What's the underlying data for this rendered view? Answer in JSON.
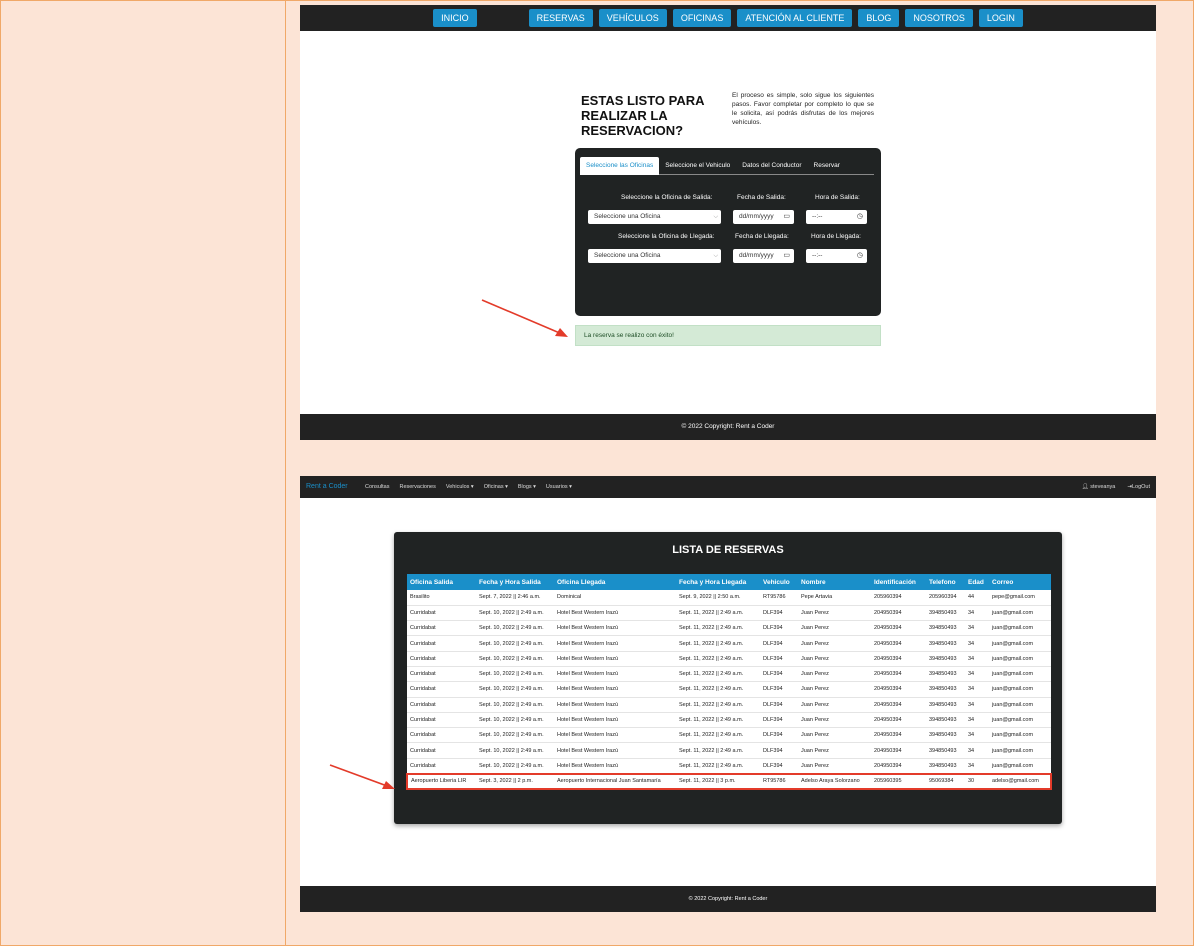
{
  "shot1": {
    "nav": [
      "INICIO",
      "RESERVAS",
      "VEHÍCULOS",
      "OFICINAS",
      "ATENCIÓN AL CLIENTE",
      "BLOG",
      "NOSOTROS",
      "LOGIN"
    ],
    "hero_title": "ESTAS LISTO PARA REALIZAR LA RESERVACION?",
    "hero_text": "El proceso es simple, solo sigue los siguientes pasos. Favor completar por completo lo que se le solicita, así podrás disfrutas de los mejores vehículos.",
    "tabs": [
      "Seleccione las Oficinas",
      "Seleccione el Vehiculo",
      "Datos del Conductor",
      "Reservar"
    ],
    "label_salida_oficina": "Seleccione la Oficina de Salida:",
    "label_fecha_salida": "Fecha de Salida:",
    "label_hora_salida": "Hora de Salida:",
    "label_llegada_oficina": "Seleccione la Oficina de Llegada:",
    "label_fecha_llegada": "Fecha de Llegada:",
    "label_hora_llegada": "Hora de Llegada:",
    "select_placeholder": "Seleccione una Oficina",
    "date_placeholder": "dd/mm/yyyy",
    "time_placeholder": "--:--",
    "success_message": "La reserva se realizo con éxito!",
    "footer": "© 2022 Copyright: Rent a Coder"
  },
  "shot2": {
    "brand": "Rent a Coder",
    "menu": [
      "Consultas",
      "Reservaciones",
      "Vehiculos ▾",
      "Oficinas ▾",
      "Blogs ▾",
      "Usuarios ▾"
    ],
    "user": "steveanya",
    "logout": "LogOut",
    "title": "LISTA DE RESERVAS",
    "columns": [
      "Oficina Salida",
      "Fecha y Hora Salida",
      "Oficina Llegada",
      "Fecha y Hora Llegada",
      "Vehiculo",
      "Nombre",
      "Identificación",
      "Telefono",
      "Edad",
      "Correo"
    ],
    "rows": [
      [
        "Brasilito",
        "Sept. 7, 2022 || 2:46 a.m.",
        "Dominical",
        "Sept. 9, 2022 || 2:50 a.m.",
        "RT95786",
        "Pepe Artavia",
        "205960394",
        "205960394",
        "44",
        "pepe@gmail.com"
      ],
      [
        "Curridabat",
        "Sept. 10, 2022 || 2:49 a.m.",
        "Hotel Best Western Irazú",
        "Sept. 11, 2022 || 2:49 a.m.",
        "DLF394",
        "Juan Perez",
        "204950394",
        "394850493",
        "34",
        "juan@gmail.com"
      ],
      [
        "Curridabat",
        "Sept. 10, 2022 || 2:49 a.m.",
        "Hotel Best Western Irazú",
        "Sept. 11, 2022 || 2:49 a.m.",
        "DLF394",
        "Juan Perez",
        "204950394",
        "394850493",
        "34",
        "juan@gmail.com"
      ],
      [
        "Curridabat",
        "Sept. 10, 2022 || 2:49 a.m.",
        "Hotel Best Western Irazú",
        "Sept. 11, 2022 || 2:49 a.m.",
        "DLF394",
        "Juan Perez",
        "204950394",
        "394850493",
        "34",
        "juan@gmail.com"
      ],
      [
        "Curridabat",
        "Sept. 10, 2022 || 2:49 a.m.",
        "Hotel Best Western Irazú",
        "Sept. 11, 2022 || 2:49 a.m.",
        "DLF394",
        "Juan Perez",
        "204950394",
        "394850493",
        "34",
        "juan@gmail.com"
      ],
      [
        "Curridabat",
        "Sept. 10, 2022 || 2:49 a.m.",
        "Hotel Best Western Irazú",
        "Sept. 11, 2022 || 2:49 a.m.",
        "DLF394",
        "Juan Perez",
        "204950394",
        "394850493",
        "34",
        "juan@gmail.com"
      ],
      [
        "Curridabat",
        "Sept. 10, 2022 || 2:49 a.m.",
        "Hotel Best Western Irazú",
        "Sept. 11, 2022 || 2:49 a.m.",
        "DLF394",
        "Juan Perez",
        "204950394",
        "394850493",
        "34",
        "juan@gmail.com"
      ],
      [
        "Curridabat",
        "Sept. 10, 2022 || 2:49 a.m.",
        "Hotel Best Western Irazú",
        "Sept. 11, 2022 || 2:49 a.m.",
        "DLF394",
        "Juan Perez",
        "204950394",
        "394850493",
        "34",
        "juan@gmail.com"
      ],
      [
        "Curridabat",
        "Sept. 10, 2022 || 2:49 a.m.",
        "Hotel Best Western Irazú",
        "Sept. 11, 2022 || 2:49 a.m.",
        "DLF394",
        "Juan Perez",
        "204950394",
        "394850493",
        "34",
        "juan@gmail.com"
      ],
      [
        "Curridabat",
        "Sept. 10, 2022 || 2:49 a.m.",
        "Hotel Best Western Irazú",
        "Sept. 11, 2022 || 2:49 a.m.",
        "DLF394",
        "Juan Perez",
        "204950394",
        "394850493",
        "34",
        "juan@gmail.com"
      ],
      [
        "Curridabat",
        "Sept. 10, 2022 || 2:49 a.m.",
        "Hotel Best Western Irazú",
        "Sept. 11, 2022 || 2:49 a.m.",
        "DLF394",
        "Juan Perez",
        "204950394",
        "394850493",
        "34",
        "juan@gmail.com"
      ],
      [
        "Curridabat",
        "Sept. 10, 2022 || 2:49 a.m.",
        "Hotel Best Western Irazú",
        "Sept. 11, 2022 || 2:49 a.m.",
        "DLF394",
        "Juan Perez",
        "204950394",
        "394850493",
        "34",
        "juan@gmail.com"
      ],
      [
        "Aeropuerto Liberia LIR",
        "Sept. 3, 2022 || 2 p.m.",
        "Aeropuerto Internacional Juan Santamaría",
        "Sept. 11, 2022 || 3 p.m.",
        "RT95786",
        "Adelso Araya Solorzano",
        "205960395",
        "95069384",
        "30",
        "adelso@gmail.com"
      ]
    ],
    "highlighted_row": 12,
    "footer": "© 2022 Copyright: Rent a Coder"
  },
  "colors": {
    "accent": "#1a8fc9",
    "annotation": "#e33b2a",
    "dark": "#202323",
    "success_bg": "#d4ead6"
  }
}
